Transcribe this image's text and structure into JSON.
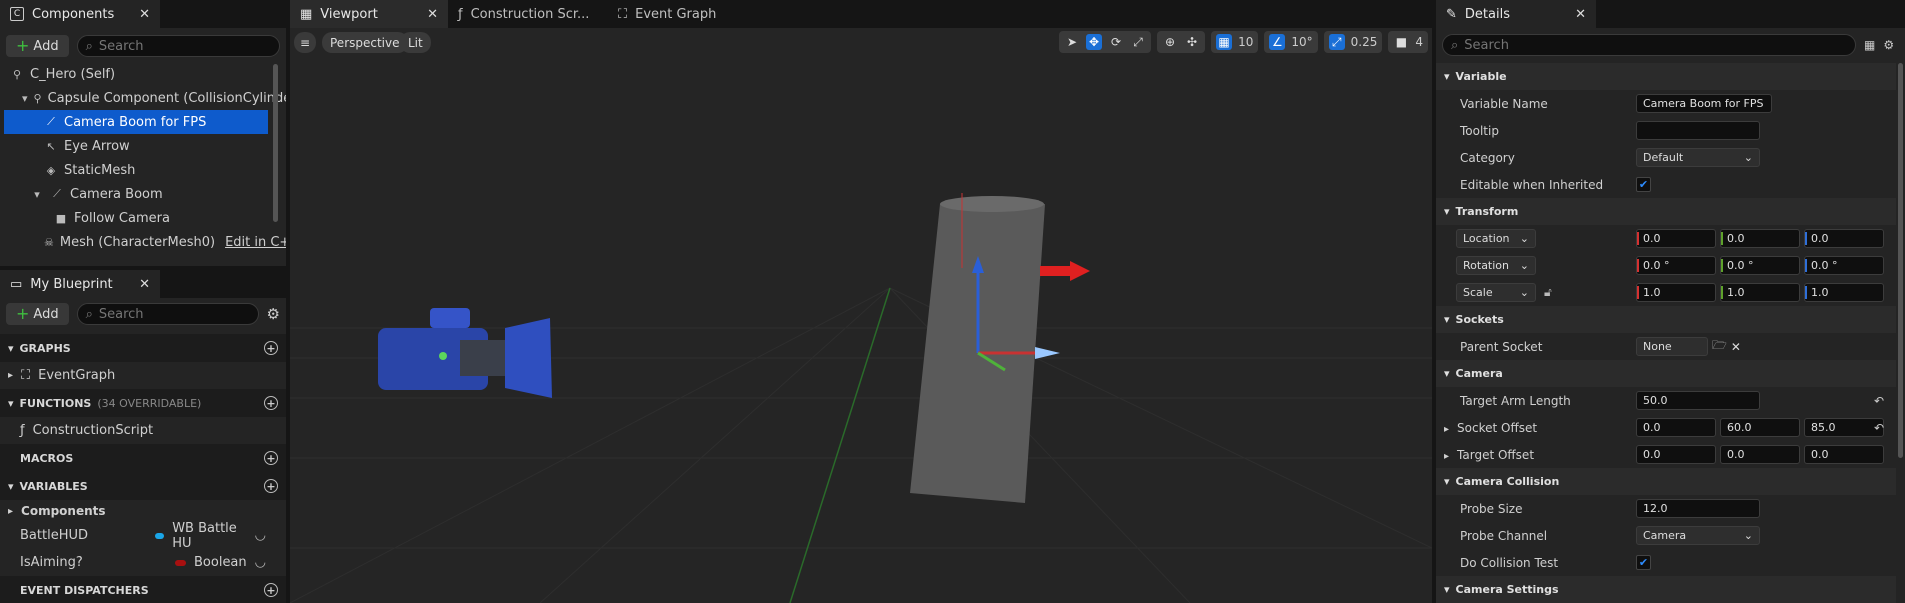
{
  "components": {
    "tab_label": "Components",
    "add_label": "Add",
    "search_placeholder": "Search",
    "items": [
      {
        "label": "C_Hero (Self)"
      },
      {
        "label": "Capsule Component (CollisionCylinde"
      },
      {
        "label": "Camera Boom for FPS"
      },
      {
        "label": "Eye Arrow"
      },
      {
        "label": "StaticMesh"
      },
      {
        "label": "Camera Boom"
      },
      {
        "label": "Follow Camera"
      },
      {
        "label": "Mesh (CharacterMesh0)",
        "link": "Edit in C+"
      }
    ]
  },
  "blueprint": {
    "tab_label": "My Blueprint",
    "add_label": "Add",
    "search_placeholder": "Search",
    "graphs_label": "GRAPHS",
    "eventgraph_label": "EventGraph",
    "functions_label": "FUNCTIONS",
    "functions_count": "(34 OVERRIDABLE)",
    "construction_label": "ConstructionScript",
    "macros_label": "MACROS",
    "variables_label": "VARIABLES",
    "components_label": "Components",
    "vars": [
      {
        "name": "BattleHUD",
        "type": "WB Battle HU",
        "color": "#1aa6e8"
      },
      {
        "name": "IsAiming?",
        "type": "Boolean",
        "color": "#a81010"
      }
    ],
    "dispatchers_label": "EVENT DISPATCHERS"
  },
  "tabs": {
    "viewport": "Viewport",
    "construction": "Construction Scr...",
    "eventgraph": "Event Graph"
  },
  "viewport": {
    "perspective": "Perspective",
    "lit": "Lit",
    "grid_snap": "10",
    "rot_snap": "10°",
    "scale_snap": "0.25",
    "cam_speed": "4"
  },
  "details": {
    "tab_label": "Details",
    "search_placeholder": "Search",
    "variable_section": "Variable",
    "variable_name_label": "Variable Name",
    "variable_name_value": "Camera Boom for FPS",
    "tooltip_label": "Tooltip",
    "category_label": "Category",
    "category_value": "Default",
    "editable_label": "Editable when Inherited",
    "transform_section": "Transform",
    "location_label": "Location",
    "location": [
      "0.0",
      "0.0",
      "0.0"
    ],
    "rotation_label": "Rotation",
    "rotation": [
      "0.0 °",
      "0.0 °",
      "0.0 °"
    ],
    "scale_label": "Scale",
    "scale": [
      "1.0",
      "1.0",
      "1.0"
    ],
    "sockets_section": "Sockets",
    "parent_socket_label": "Parent Socket",
    "parent_socket_value": "None",
    "camera_section": "Camera",
    "target_arm_label": "Target Arm Length",
    "target_arm_value": "50.0",
    "socket_offset_label": "Socket Offset",
    "socket_offset": [
      "0.0",
      "60.0",
      "85.0"
    ],
    "target_offset_label": "Target Offset",
    "target_offset": [
      "0.0",
      "0.0",
      "0.0"
    ],
    "collision_section": "Camera Collision",
    "probe_size_label": "Probe Size",
    "probe_size_value": "12.0",
    "probe_channel_label": "Probe Channel",
    "probe_channel_value": "Camera",
    "do_collision_label": "Do Collision Test",
    "camera_settings_section": "Camera Settings"
  }
}
